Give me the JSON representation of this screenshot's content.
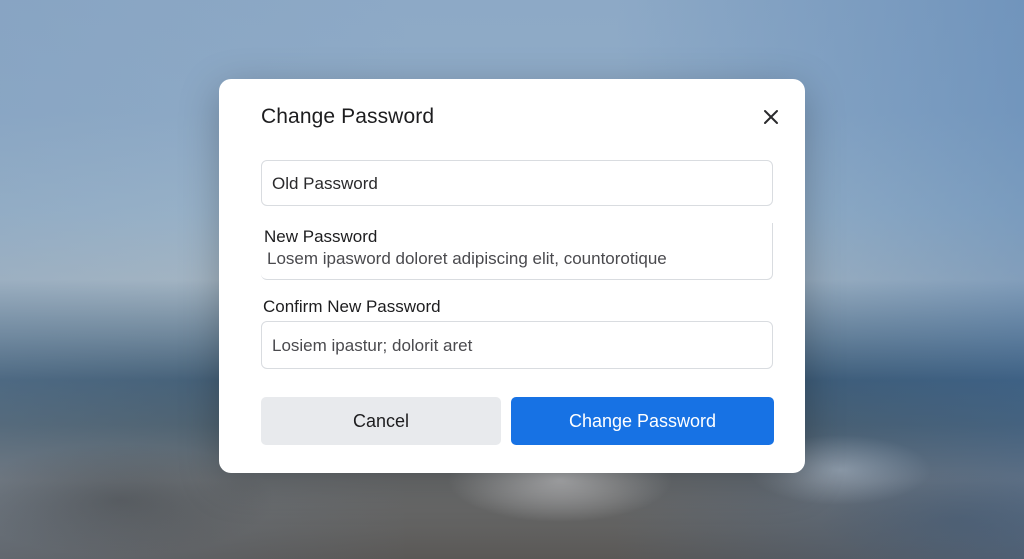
{
  "dialog": {
    "title": "Change Password",
    "close_icon": "close-icon"
  },
  "fields": {
    "old_password": {
      "placeholder": "Old Password"
    },
    "new_password": {
      "label": "New Password",
      "value": "Losem ipasword doloret adipiscing elit, countorotique"
    },
    "confirm_password": {
      "label": "Confirm New Password",
      "value": "Losiem ipastur; dolorit aret"
    }
  },
  "buttons": {
    "cancel_label": "Cancel",
    "submit_label": "Change Password"
  },
  "colors": {
    "primary": "#1772e4",
    "secondary_button": "#e8eaed"
  }
}
